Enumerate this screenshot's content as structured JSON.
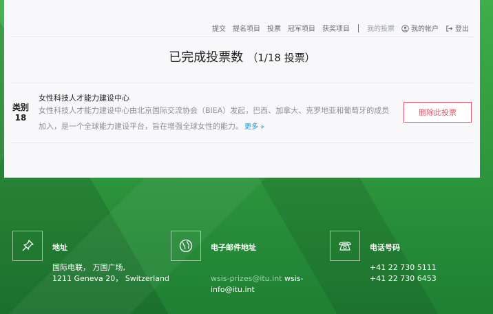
{
  "nav": {
    "items": [
      "提交",
      "提名项目",
      "投票",
      "冠军项目",
      "获奖项目"
    ],
    "my_votes": "我的投票",
    "my_account": "我的帐户",
    "logout": "登出"
  },
  "page": {
    "title": "已完成投票数",
    "count": "（1/18 投票）"
  },
  "vote_item": {
    "category_label": "类别",
    "category_number": "18",
    "title": "女性科技人才能力建设中心",
    "description": "女性科技人才能力建设中心由北京国际交流协会（BIEA）发起，巴西、加拿大、克罗地亚和葡萄牙的成员加入，是一个全球能力建设平台，旨在增强全球女性的能力。",
    "more": "更多 »",
    "delete_button": "删除此投票"
  },
  "footer": {
    "address": {
      "heading": "地址",
      "line1": "国际电联， 万国广场,",
      "line2": "1211 Geneva 20， Switzerland",
      "icon": "pin-icon"
    },
    "email": {
      "heading": "电子邮件地址",
      "email1": "wsis-prizes@itu.int",
      "email2_a": "wsis-",
      "email2_b": "info@itu.int",
      "icon": "globe-icon"
    },
    "phone": {
      "heading": "电话号码",
      "line1": "+41 22 730 5111",
      "line2": "+41 22 730 6453",
      "icon": "phone-icon"
    }
  }
}
